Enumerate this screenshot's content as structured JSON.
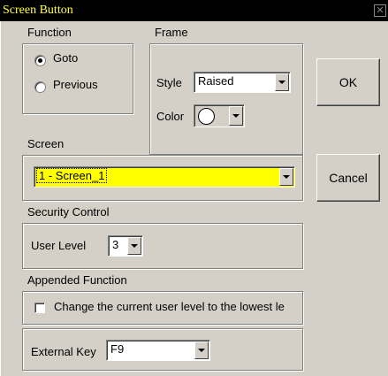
{
  "window": {
    "title": "Screen Button"
  },
  "function_group": {
    "label": "Function",
    "options": [
      "Goto",
      "Previous"
    ],
    "selected": "Goto"
  },
  "frame_group": {
    "label": "Frame",
    "style_label": "Style",
    "style_value": "Raised",
    "color_label": "Color",
    "color_value": "#ffffff"
  },
  "screen_group": {
    "label": "Screen",
    "value": "1 - Screen_1",
    "highlight_color": "#ffff00"
  },
  "security_group": {
    "label": "Security Control",
    "user_level_label": "User Level",
    "user_level_value": "3"
  },
  "appended_group": {
    "label": "Appended Function",
    "checkbox_label": "Change the current user level to the lowest le",
    "checked": false
  },
  "external_key": {
    "label": "External Key",
    "value": "F9"
  },
  "buttons": {
    "ok": "OK",
    "cancel": "Cancel"
  },
  "icons": {
    "close": "close-icon",
    "dropdown": "chevron-down-icon"
  }
}
